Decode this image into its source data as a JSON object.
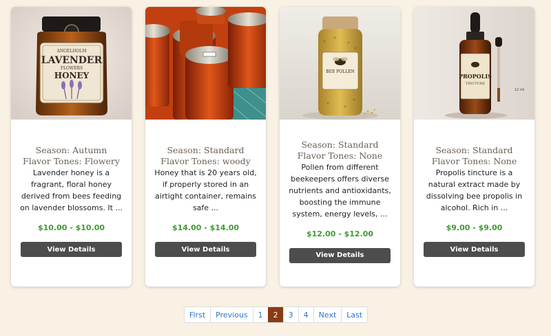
{
  "products": [
    {
      "image": "lavender-honey-jar-image",
      "image_label": [
        "ANGELHOLM",
        "LAVENDER",
        "FLOWERS",
        "HONEY"
      ],
      "season": "Season: Autumn",
      "flavor": "Flavor Tones: Flowery",
      "description": "Lavender honey is a fragrant, floral honey derived from bees feeding on lavender blossoms. It ...",
      "price": "$10.00 - $10.00",
      "button": "View Details"
    },
    {
      "image": "honey-mason-jars-image",
      "season": "Season: Standard",
      "flavor": "Flavor Tones: woody",
      "description": "Honey that is 20 years old, if properly stored in an airtight container, remains safe ...",
      "price": "$14.00 - $14.00",
      "button": "View Details"
    },
    {
      "image": "bee-pollen-jar-image",
      "image_label": [
        "BEE POLLEN"
      ],
      "season": "Season: Standard",
      "flavor": "Flavor Tones: None",
      "description": "Pollen from different beekeepers offers diverse nutrients and antioxidants, boosting the immune system, energy levels, ...",
      "price": "$12.00 - $12.00",
      "button": "View Details"
    },
    {
      "image": "propolis-tincture-bottle-image",
      "image_label": [
        "PROPOLIS",
        "TINCTURE",
        "12 ml"
      ],
      "season": "Season: Standard",
      "flavor": "Flavor Tones: None",
      "description": "Propolis tincture is a natural extract made by dissolving bee propolis in alcohol. Rich in ...",
      "price": "$9.00 - $9.00",
      "button": "View Details"
    }
  ],
  "pagination": {
    "items": [
      "First",
      "Previous",
      "1",
      "2",
      "3",
      "4",
      "Next",
      "Last"
    ],
    "active": "2"
  },
  "colors": {
    "page_bg": "#f8f1e4",
    "price": "#3f9a33",
    "button_bg": "#4d4d4d",
    "pager_active": "#8a3b14",
    "link": "#2a76c6"
  }
}
